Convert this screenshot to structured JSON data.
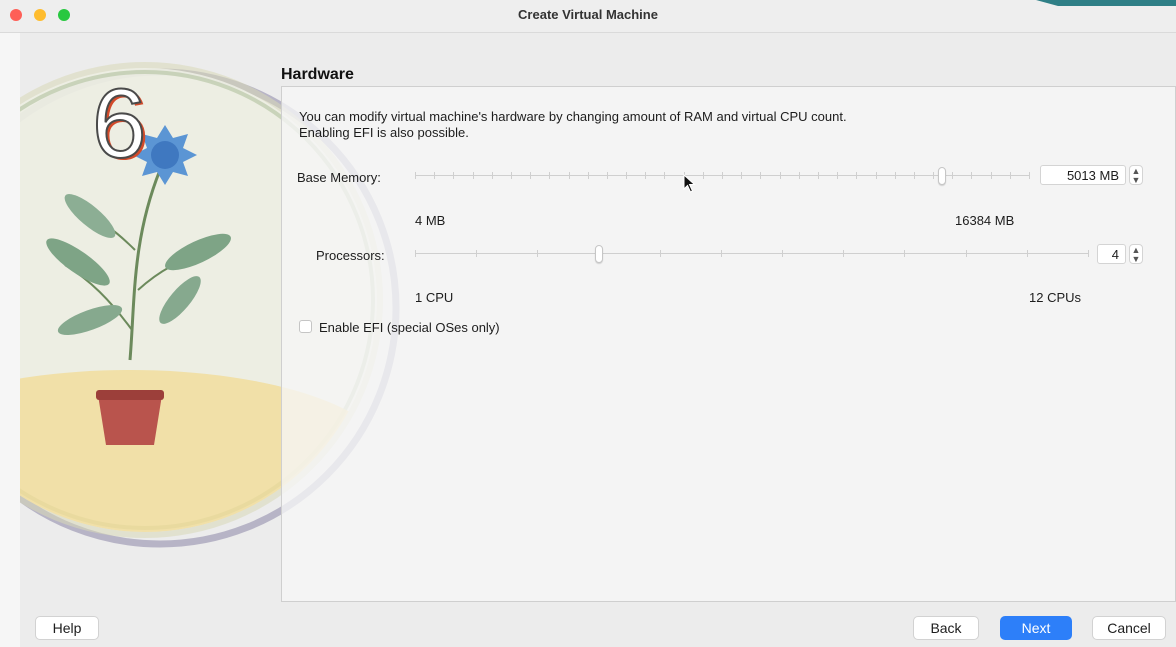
{
  "window": {
    "title": "Create Virtual Machine"
  },
  "overlay": {
    "step_number": "6"
  },
  "section": {
    "title": "Hardware",
    "description_line1": "You can modify virtual machine's hardware by changing amount of RAM and virtual CPU count.",
    "description_line2": "Enabling EFI is also possible."
  },
  "memory": {
    "label": "Base Memory:",
    "value": "5013 MB",
    "value_mb": 5013,
    "min_label": "4 MB",
    "max_label": "16384 MB",
    "min": 4,
    "max": 16384
  },
  "processors": {
    "label": "Processors:",
    "value": "4",
    "value_count": 4,
    "min_label": "1 CPU",
    "max_label": "12 CPUs",
    "min": 1,
    "max": 12
  },
  "efi": {
    "label": "Enable EFI (special OSes only)",
    "checked": false
  },
  "buttons": {
    "help": "Help",
    "back": "Back",
    "next": "Next",
    "cancel": "Cancel"
  },
  "colors": {
    "accent": "#2d7ff9",
    "close": "#fe5f57",
    "minimize": "#febc2e",
    "maximize": "#28c840"
  },
  "icons": [
    "plant-illustration",
    "stepper-icon",
    "mouse-cursor-icon"
  ]
}
